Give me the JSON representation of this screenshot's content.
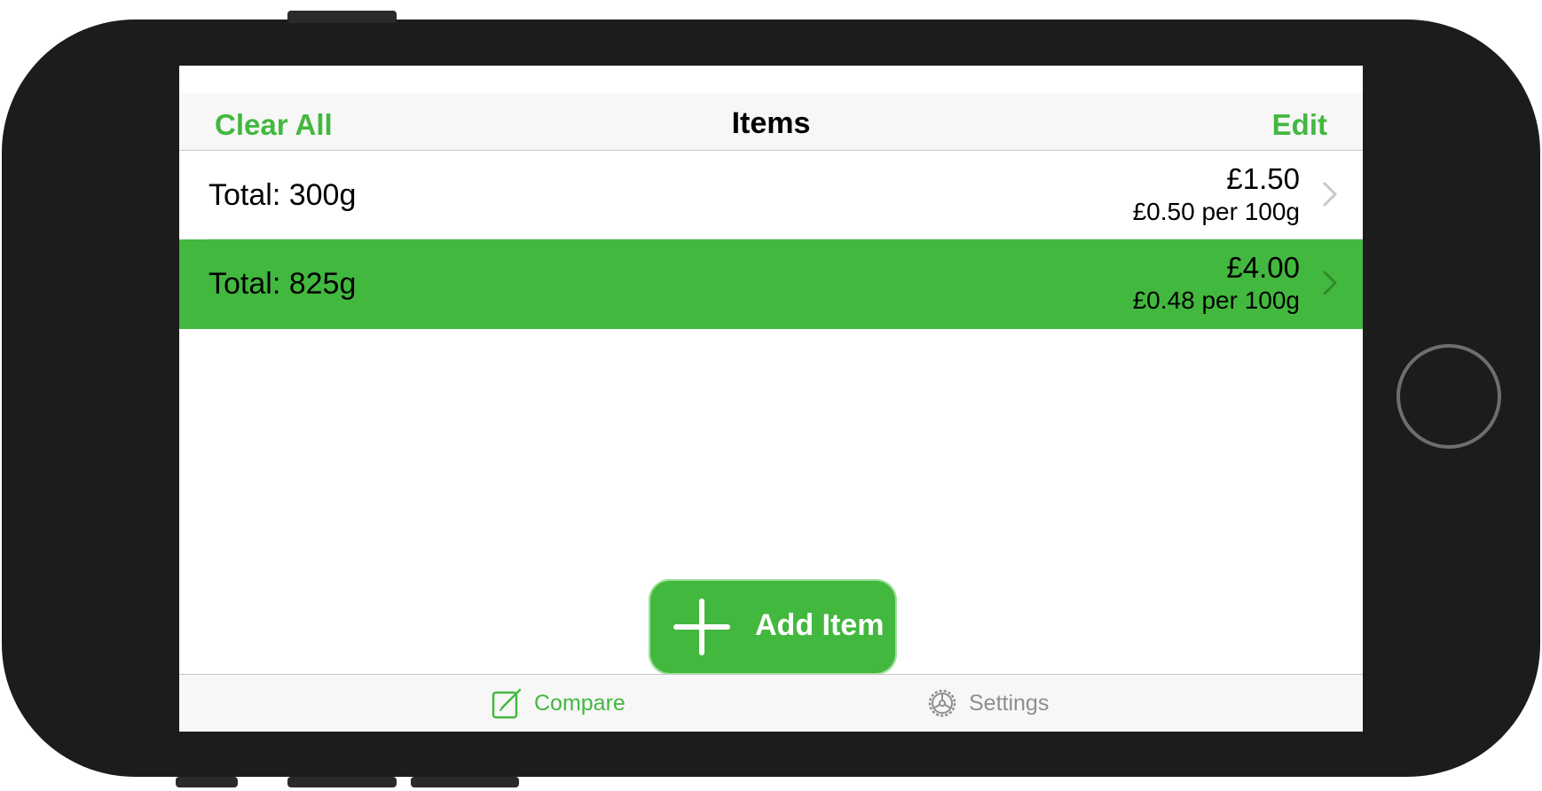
{
  "navbar": {
    "left_button": "Clear All",
    "title": "Items",
    "right_button": "Edit"
  },
  "items": [
    {
      "title": "Total: 300g",
      "price": "£1.50",
      "unit_price": "£0.50 per 100g",
      "selected": false
    },
    {
      "title": "Total: 825g",
      "price": "£4.00",
      "unit_price": "£0.48 per 100g",
      "selected": true
    }
  ],
  "add_button": {
    "label": "Add Item",
    "icon": "plus-icon"
  },
  "tabbar": {
    "tabs": [
      {
        "label": "Compare",
        "icon": "compose-icon",
        "active": true
      },
      {
        "label": "Settings",
        "icon": "gear-icon",
        "active": false
      }
    ]
  },
  "colors": {
    "accent": "#43b83f",
    "frame": "#1c1c1c",
    "inactive_tab": "#8e8e93"
  }
}
